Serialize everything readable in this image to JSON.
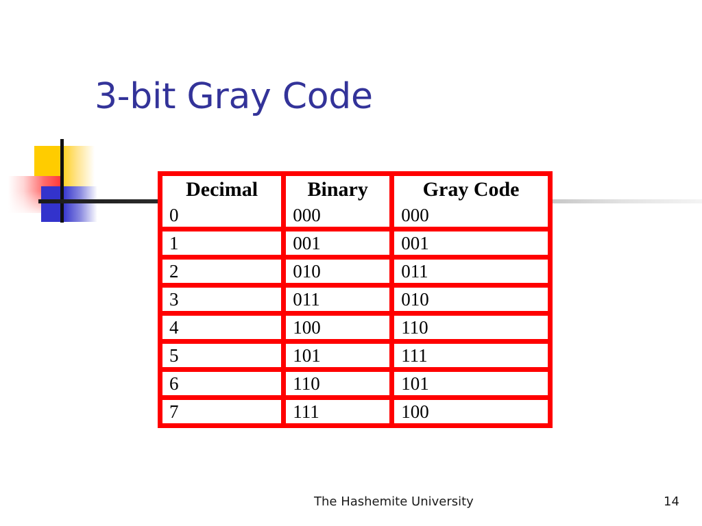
{
  "slide": {
    "title": "3-bit Gray Code",
    "title_color": "#333399",
    "background_color": "#ffffff"
  },
  "decoration": {
    "yellow_color": "#FFCC00",
    "red_color": "#FF3333",
    "blue_color": "#3333CC",
    "line_color": "#1a1a1a"
  },
  "table": {
    "border_color": "#FF0000",
    "headers": [
      "Decimal",
      "Binary",
      "Gray Code"
    ],
    "rows": [
      [
        "0",
        "000",
        "000"
      ],
      [
        "1",
        "001",
        "001"
      ],
      [
        "2",
        "010",
        "011"
      ],
      [
        "3",
        "011",
        "010"
      ],
      [
        "4",
        "100",
        "110"
      ],
      [
        "5",
        "101",
        "111"
      ],
      [
        "6",
        "110",
        "101"
      ],
      [
        "7",
        "111",
        "100"
      ]
    ]
  },
  "footer": {
    "university": "The Hashemite University",
    "page_number": "14"
  }
}
